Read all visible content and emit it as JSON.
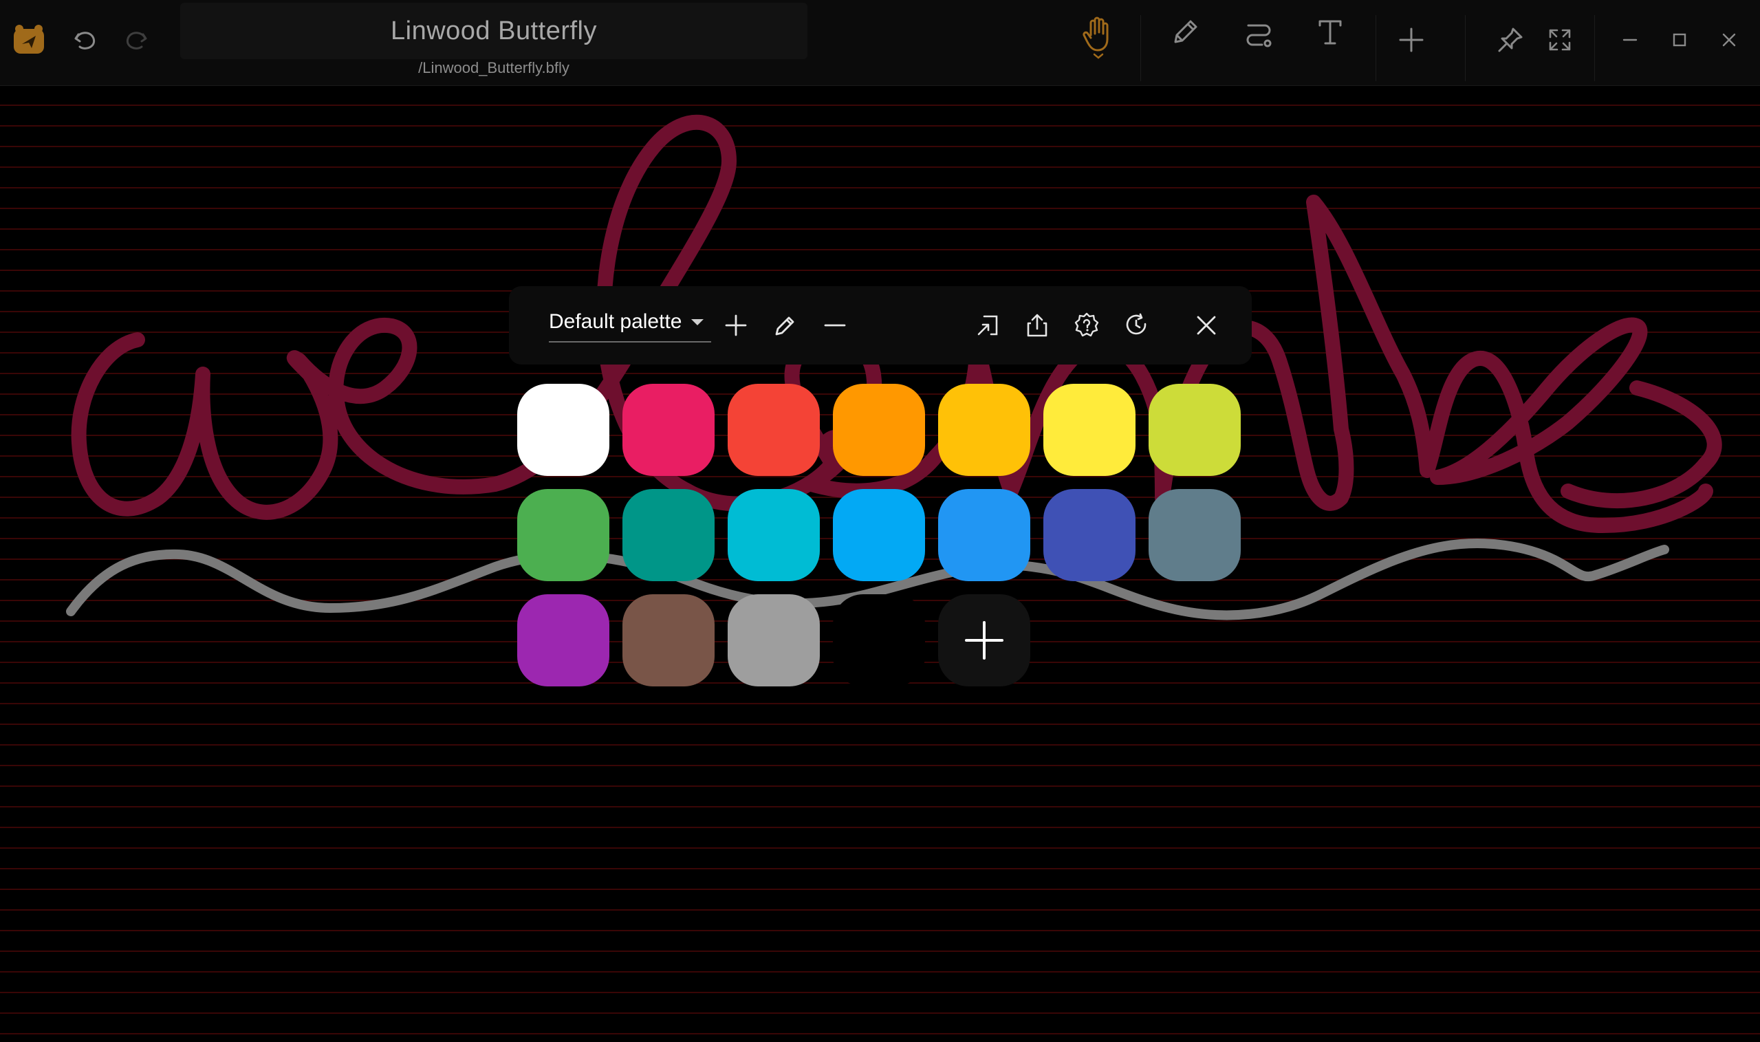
{
  "app": {
    "title": "Linwood Butterfly",
    "path": "/Linwood_Butterfly.bfly",
    "accent": "#a06a1a"
  },
  "topbar": {
    "left_icons": [
      "app-logo-icon",
      "undo-icon",
      "redo-icon"
    ],
    "tools": [
      "hand-icon",
      "pen-icon",
      "path-icon",
      "text-icon",
      "add-icon"
    ],
    "right_icons": [
      "pin-icon",
      "fullscreen-icon",
      "minimize-icon",
      "maximize-icon",
      "close-icon"
    ]
  },
  "palette": {
    "name": "Default palette",
    "toolbar_icons": [
      "add-icon",
      "edit-icon",
      "remove-icon",
      "import-icon",
      "export-icon",
      "settings-help-icon",
      "reset-icon",
      "close-icon"
    ],
    "colors": [
      "#ffffff",
      "#e91e63",
      "#f44336",
      "#ff9800",
      "#ffc107",
      "#ffeb3b",
      "#cddc39",
      "#4caf50",
      "#009688",
      "#00bcd4",
      "#03a9f4",
      "#2196f3",
      "#3f51b5",
      "#607d8b",
      "#9c27b0",
      "#795548",
      "#9e9e9e",
      "#000000"
    ],
    "add_color_icon": "plus-icon"
  },
  "canvas": {
    "background": "#000000",
    "line_color": "#3a0606",
    "strokes": [
      {
        "name": "welcome-handwriting",
        "color": "#6e0f2e"
      },
      {
        "name": "gray-wave",
        "color": "#7a7a7a"
      }
    ]
  }
}
